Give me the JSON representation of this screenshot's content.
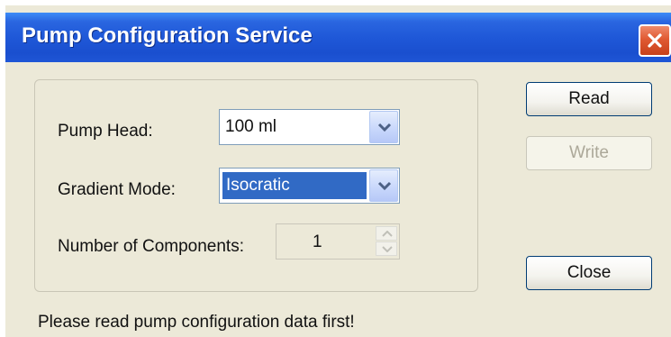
{
  "window": {
    "title": "Pump Configuration Service"
  },
  "form": {
    "pump_head": {
      "label": "Pump Head:",
      "value": "100 ml"
    },
    "gradient_mode": {
      "label": "Gradient Mode:",
      "value": "Isocratic"
    },
    "num_components": {
      "label": "Number of Components:",
      "value": "1"
    }
  },
  "buttons": {
    "read": "Read",
    "write": "Write",
    "close": "Close"
  },
  "status": {
    "message": "Please read pump configuration data first!"
  },
  "icons": [
    "close-icon",
    "chevron-down-icon",
    "spinner-up-icon",
    "spinner-down-icon"
  ],
  "colors": {
    "titlebar": "#1f58d8",
    "close_button": "#e05a33",
    "selection": "#316ac5",
    "dialog_face": "#ece9d8"
  }
}
